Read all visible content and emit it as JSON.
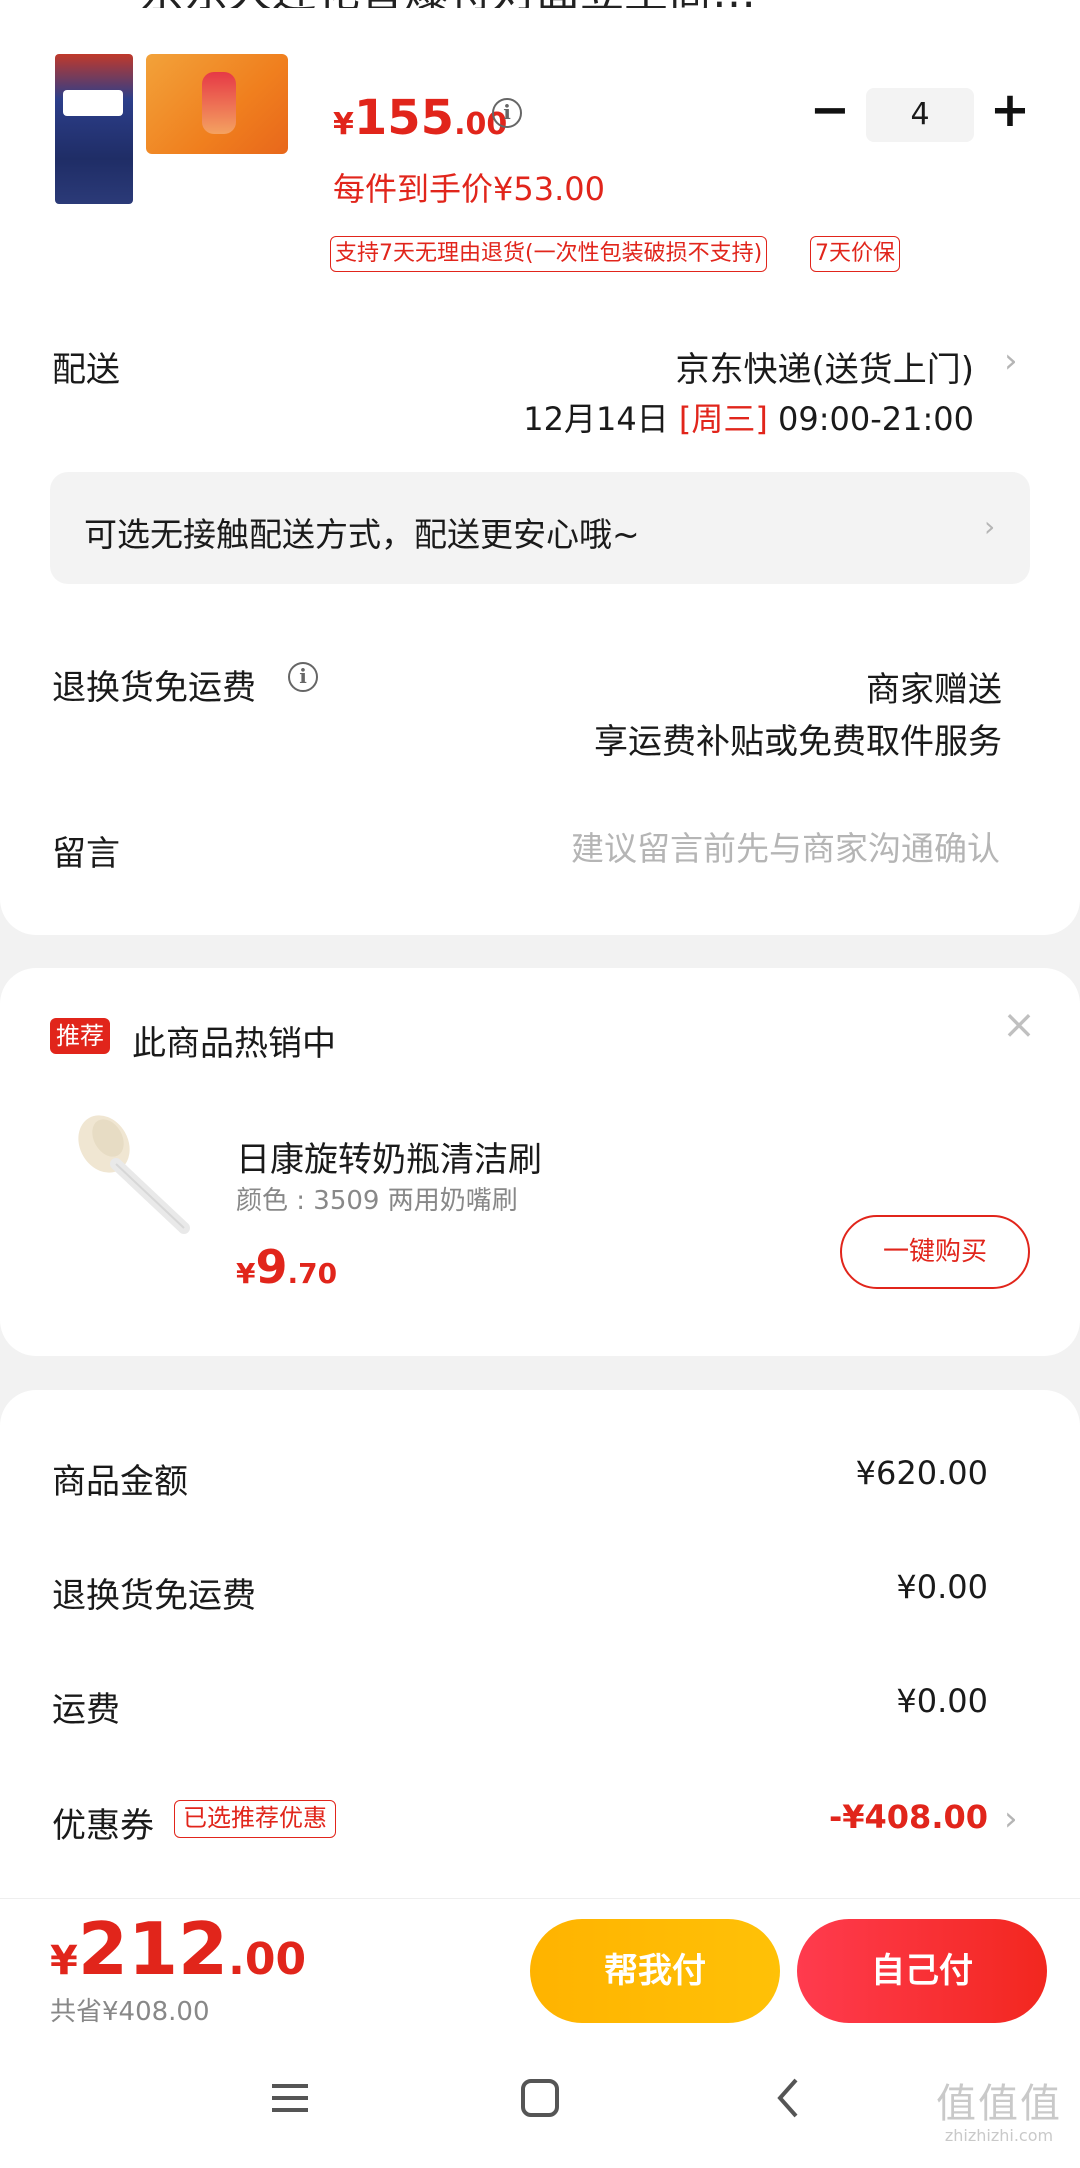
{
  "header": {
    "back_icon": "chevron-left-icon",
    "title": "京东大连花音爆特对面立至商…"
  },
  "product": {
    "price_currency": "¥",
    "price_int": "155",
    "price_dec": ".00",
    "quantity": "4",
    "unit_price_text": "每件到手价¥53.00",
    "service_tags": [
      "支持7天无理由退货(一次性包装破损不支持)",
      "7天价保"
    ]
  },
  "delivery": {
    "label": "配送",
    "method": "京东快递(送货上门)",
    "date": "12月14日",
    "weekday": "[周三]",
    "time": "09:00-21:00"
  },
  "contactless": {
    "text": "可选无接触配送方式，配送更安心哦~"
  },
  "return_shipping": {
    "label": "退换货免运费",
    "line1": "商家赠送",
    "line2": "享运费补贴或免费取件服务"
  },
  "message": {
    "label": "留言",
    "placeholder": "建议留言前先与商家沟通确认"
  },
  "recommend": {
    "badge": "推荐",
    "title": "此商品热销中",
    "item_name": "日康旋转奶瓶清洁刷",
    "item_spec": "颜色 : 3509 两用奶嘴刷",
    "price_currency": "¥",
    "price_int": "9",
    "price_dec": ".70",
    "buy_label": "一键购买"
  },
  "summary": {
    "rows": [
      {
        "label": "商品金额",
        "value": "¥620.00"
      },
      {
        "label": "退换货免运费",
        "value": "¥0.00"
      },
      {
        "label": "运费",
        "value": "¥0.00"
      },
      {
        "label": "优惠券",
        "value": "-¥408.00",
        "tag": "已选推荐优惠"
      }
    ]
  },
  "paybar": {
    "total_currency": "¥",
    "total_int": "212",
    "total_dec": ".00",
    "saved": "共省¥408.00",
    "help_pay": "帮我付",
    "self_pay": "自己付"
  },
  "watermark": {
    "logo": "值值值",
    "url": "zhizhizhi.com"
  },
  "colors": {
    "accent": "#e1251b",
    "help_pay": "#ffb300",
    "self_pay": "#f2271f"
  }
}
